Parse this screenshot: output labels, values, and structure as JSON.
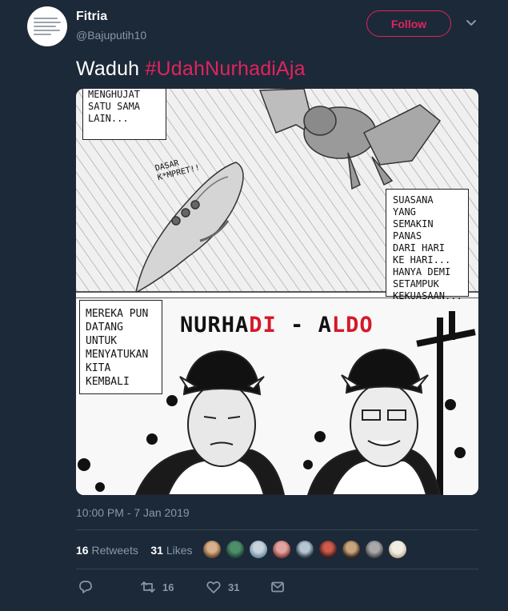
{
  "user": {
    "name": "Fitria",
    "handle": "@Bajuputih10",
    "follow_label": "Follow"
  },
  "tweet": {
    "text_plain": "Waduh ",
    "hashtag": "#UdahNurhadiAja"
  },
  "comic": {
    "speech_top_left": "MENGHUJAT\nSATU SAMA\nLAIN...",
    "shout": "DASAR\nK*MPRET!!",
    "speech_right": "SUASANA YANG\nSEMAKIN\nPANAS\nDARI HARI\nKE HARI...\nHANYA DEMI\nSETAMPUK\nKEKUASAAN...",
    "speech_bottom_left": "MEREKA PUN\nDATANG\nUNTUK\nMENYATUKAN\nKITA KEMBALI",
    "title_a": "NURHA",
    "title_b": "DI",
    "title_c": " - A",
    "title_d": "LDO"
  },
  "timestamp": "10:00 PM - 7 Jan 2019",
  "stats": {
    "retweets_count": "16",
    "retweets_label": "Retweets",
    "likes_count": "31",
    "likes_label": "Likes"
  },
  "actions": {
    "reply_icon": "reply-icon",
    "retweet_count": "16",
    "like_count": "31",
    "dm_icon": "envelope-icon"
  },
  "colors": {
    "background": "#1c2938",
    "accent": "#e0245e",
    "muted": "#8899a6",
    "divider": "#38444d"
  }
}
